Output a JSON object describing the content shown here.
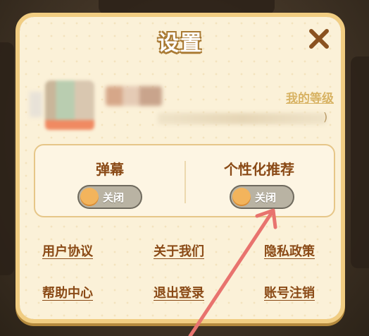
{
  "dialog": {
    "title": "设置"
  },
  "profile": {
    "uid_suffix": ")",
    "level_link": "我的等级"
  },
  "toggles": [
    {
      "label": "弹幕",
      "state_label": "关闭",
      "enabled": false
    },
    {
      "label": "个性化推荐",
      "state_label": "关闭",
      "enabled": false
    }
  ],
  "links": {
    "row1": [
      "用户协议",
      "关于我们",
      "隐私政策"
    ],
    "row2": [
      "帮助中心",
      "退出登录",
      "账号注销"
    ]
  },
  "colors": {
    "panel_bg": "#fbf1d8",
    "panel_border": "#f1cd82",
    "title_outline": "#a97a34",
    "label_text": "#8a4a16",
    "level_link": "#d8b364",
    "switch_off_bg": "#b9b3a3",
    "switch_knob": "#f3b45c",
    "close_x": "#8a5220",
    "annotation_arrow": "#e8736e"
  },
  "icons": {
    "close": "close-icon",
    "annotation": "arrow-annotation"
  }
}
